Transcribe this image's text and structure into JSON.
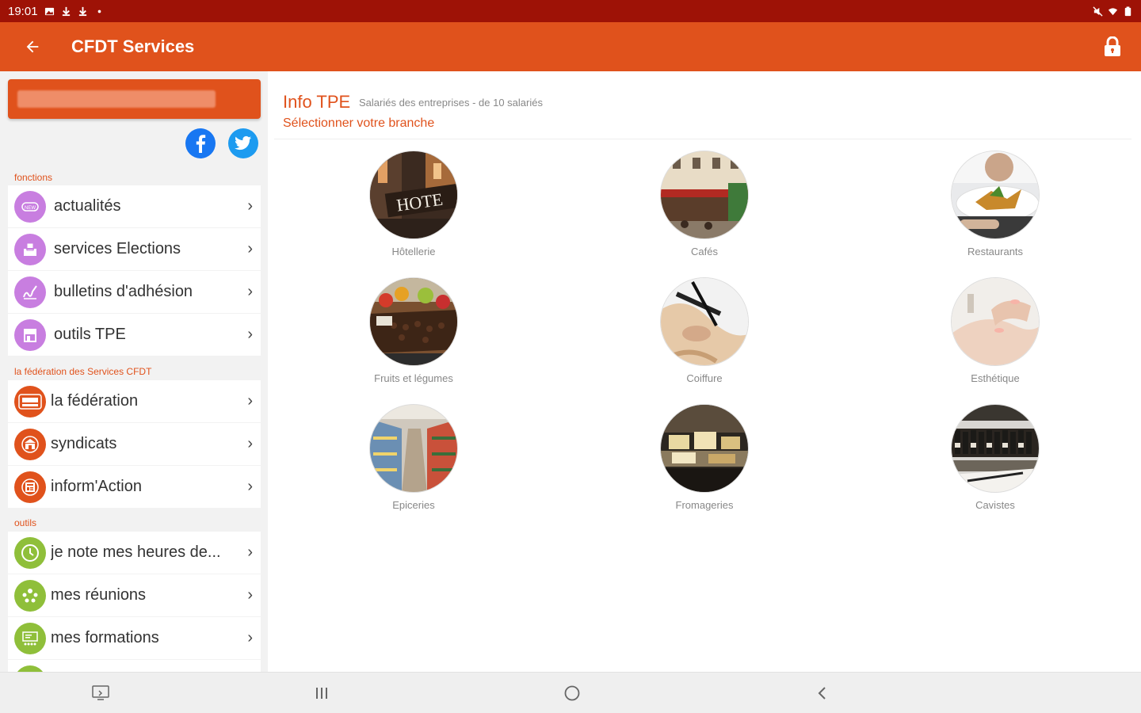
{
  "status_bar": {
    "time": "19:01"
  },
  "app_bar": {
    "title": "CFDT Services"
  },
  "sidebar": {
    "sections": [
      {
        "label": "fonctions"
      },
      {
        "label": "la fédération des Services CFDT"
      },
      {
        "label": "outils"
      }
    ],
    "fonctions": [
      {
        "label": "actualités",
        "icon": "news-icon"
      },
      {
        "label": "services Elections",
        "icon": "ballot-icon"
      },
      {
        "label": "bulletins d'adhésion",
        "icon": "signature-icon"
      },
      {
        "label": "outils TPE",
        "icon": "shop-icon"
      }
    ],
    "federation": [
      {
        "label": "la fédération",
        "icon": "cfdt-logo-icon"
      },
      {
        "label": "syndicats",
        "icon": "building-icon"
      },
      {
        "label": "inform'Action",
        "icon": "newspaper-icon"
      }
    ],
    "outils": [
      {
        "label": "je note mes heures de...",
        "icon": "clock-icon"
      },
      {
        "label": "mes réunions",
        "icon": "people-icon"
      },
      {
        "label": "mes formations",
        "icon": "training-icon"
      }
    ]
  },
  "main": {
    "title": "Info TPE",
    "subtitle": "Salariés des entreprises - de 10 salariés",
    "select_label": "Sélectionner votre branche",
    "branches": [
      {
        "label": "Hôtellerie",
        "photo": "hotel"
      },
      {
        "label": "Cafés",
        "photo": "cafe"
      },
      {
        "label": "Restaurants",
        "photo": "restaurant"
      },
      {
        "label": "Fruits et légumes",
        "photo": "fruits"
      },
      {
        "label": "Coiffure",
        "photo": "hair"
      },
      {
        "label": "Esthétique",
        "photo": "nails"
      },
      {
        "label": "Epiceries",
        "photo": "grocery"
      },
      {
        "label": "Fromageries",
        "photo": "cheese"
      },
      {
        "label": "Cavistes",
        "photo": "wine"
      }
    ]
  },
  "colors": {
    "status_bar": "#9e1206",
    "app_bar": "#e0521c",
    "accent": "#e0521c",
    "purple_icons": "#c87ee0",
    "green_icons": "#8fbf3a"
  }
}
